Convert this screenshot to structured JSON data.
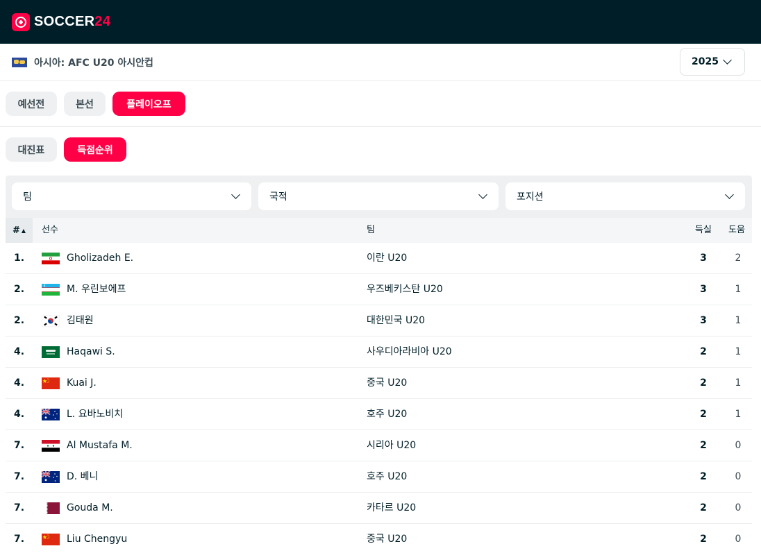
{
  "brand": {
    "name_white": "SOCCER",
    "name_red": "24"
  },
  "league": {
    "name": "아시아: AFC U20 아시안컵",
    "season": "2025"
  },
  "stage_tabs": [
    {
      "label": "예선전",
      "active": false
    },
    {
      "label": "본선",
      "active": false
    },
    {
      "label": "플레이오프",
      "active": true
    }
  ],
  "view_tabs": [
    {
      "label": "대진표",
      "active": false
    },
    {
      "label": "득점순위",
      "active": true
    }
  ],
  "filters": {
    "team": "팀",
    "nationality": "국적",
    "position": "포지션"
  },
  "table": {
    "headers": {
      "rank": "#",
      "player": "선수",
      "team": "팀",
      "goals": "득실",
      "assists": "도움"
    },
    "rows": [
      {
        "rank": "1.",
        "player": "Gholizadeh E.",
        "team": "이란 U20",
        "goals": "3",
        "assists": "2",
        "flag": "iran"
      },
      {
        "rank": "2.",
        "player": "M. 우린보에프",
        "team": "우즈베키스탄 U20",
        "goals": "3",
        "assists": "1",
        "flag": "uzbekistan"
      },
      {
        "rank": "2.",
        "player": "김태원",
        "team": "대한민국 U20",
        "goals": "3",
        "assists": "1",
        "flag": "south-korea"
      },
      {
        "rank": "4.",
        "player": "Haqawi S.",
        "team": "사우디아라비아 U20",
        "goals": "2",
        "assists": "1",
        "flag": "saudi-arabia"
      },
      {
        "rank": "4.",
        "player": "Kuai J.",
        "team": "중국 U20",
        "goals": "2",
        "assists": "1",
        "flag": "china"
      },
      {
        "rank": "4.",
        "player": "L. 요바노비치",
        "team": "호주 U20",
        "goals": "2",
        "assists": "1",
        "flag": "australia"
      },
      {
        "rank": "7.",
        "player": "Al Mustafa M.",
        "team": "시리아 U20",
        "goals": "2",
        "assists": "0",
        "flag": "syria"
      },
      {
        "rank": "7.",
        "player": "D. 베니",
        "team": "호주 U20",
        "goals": "2",
        "assists": "0",
        "flag": "australia"
      },
      {
        "rank": "7.",
        "player": "Gouda M.",
        "team": "카타르 U20",
        "goals": "2",
        "assists": "0",
        "flag": "qatar"
      },
      {
        "rank": "7.",
        "player": "Liu Chengyu",
        "team": "중국 U20",
        "goals": "2",
        "assists": "0",
        "flag": "china"
      }
    ]
  },
  "colors": {
    "accent": "#ff0046",
    "header_bg": "#001e28",
    "pill_bg": "#eef0f1"
  }
}
